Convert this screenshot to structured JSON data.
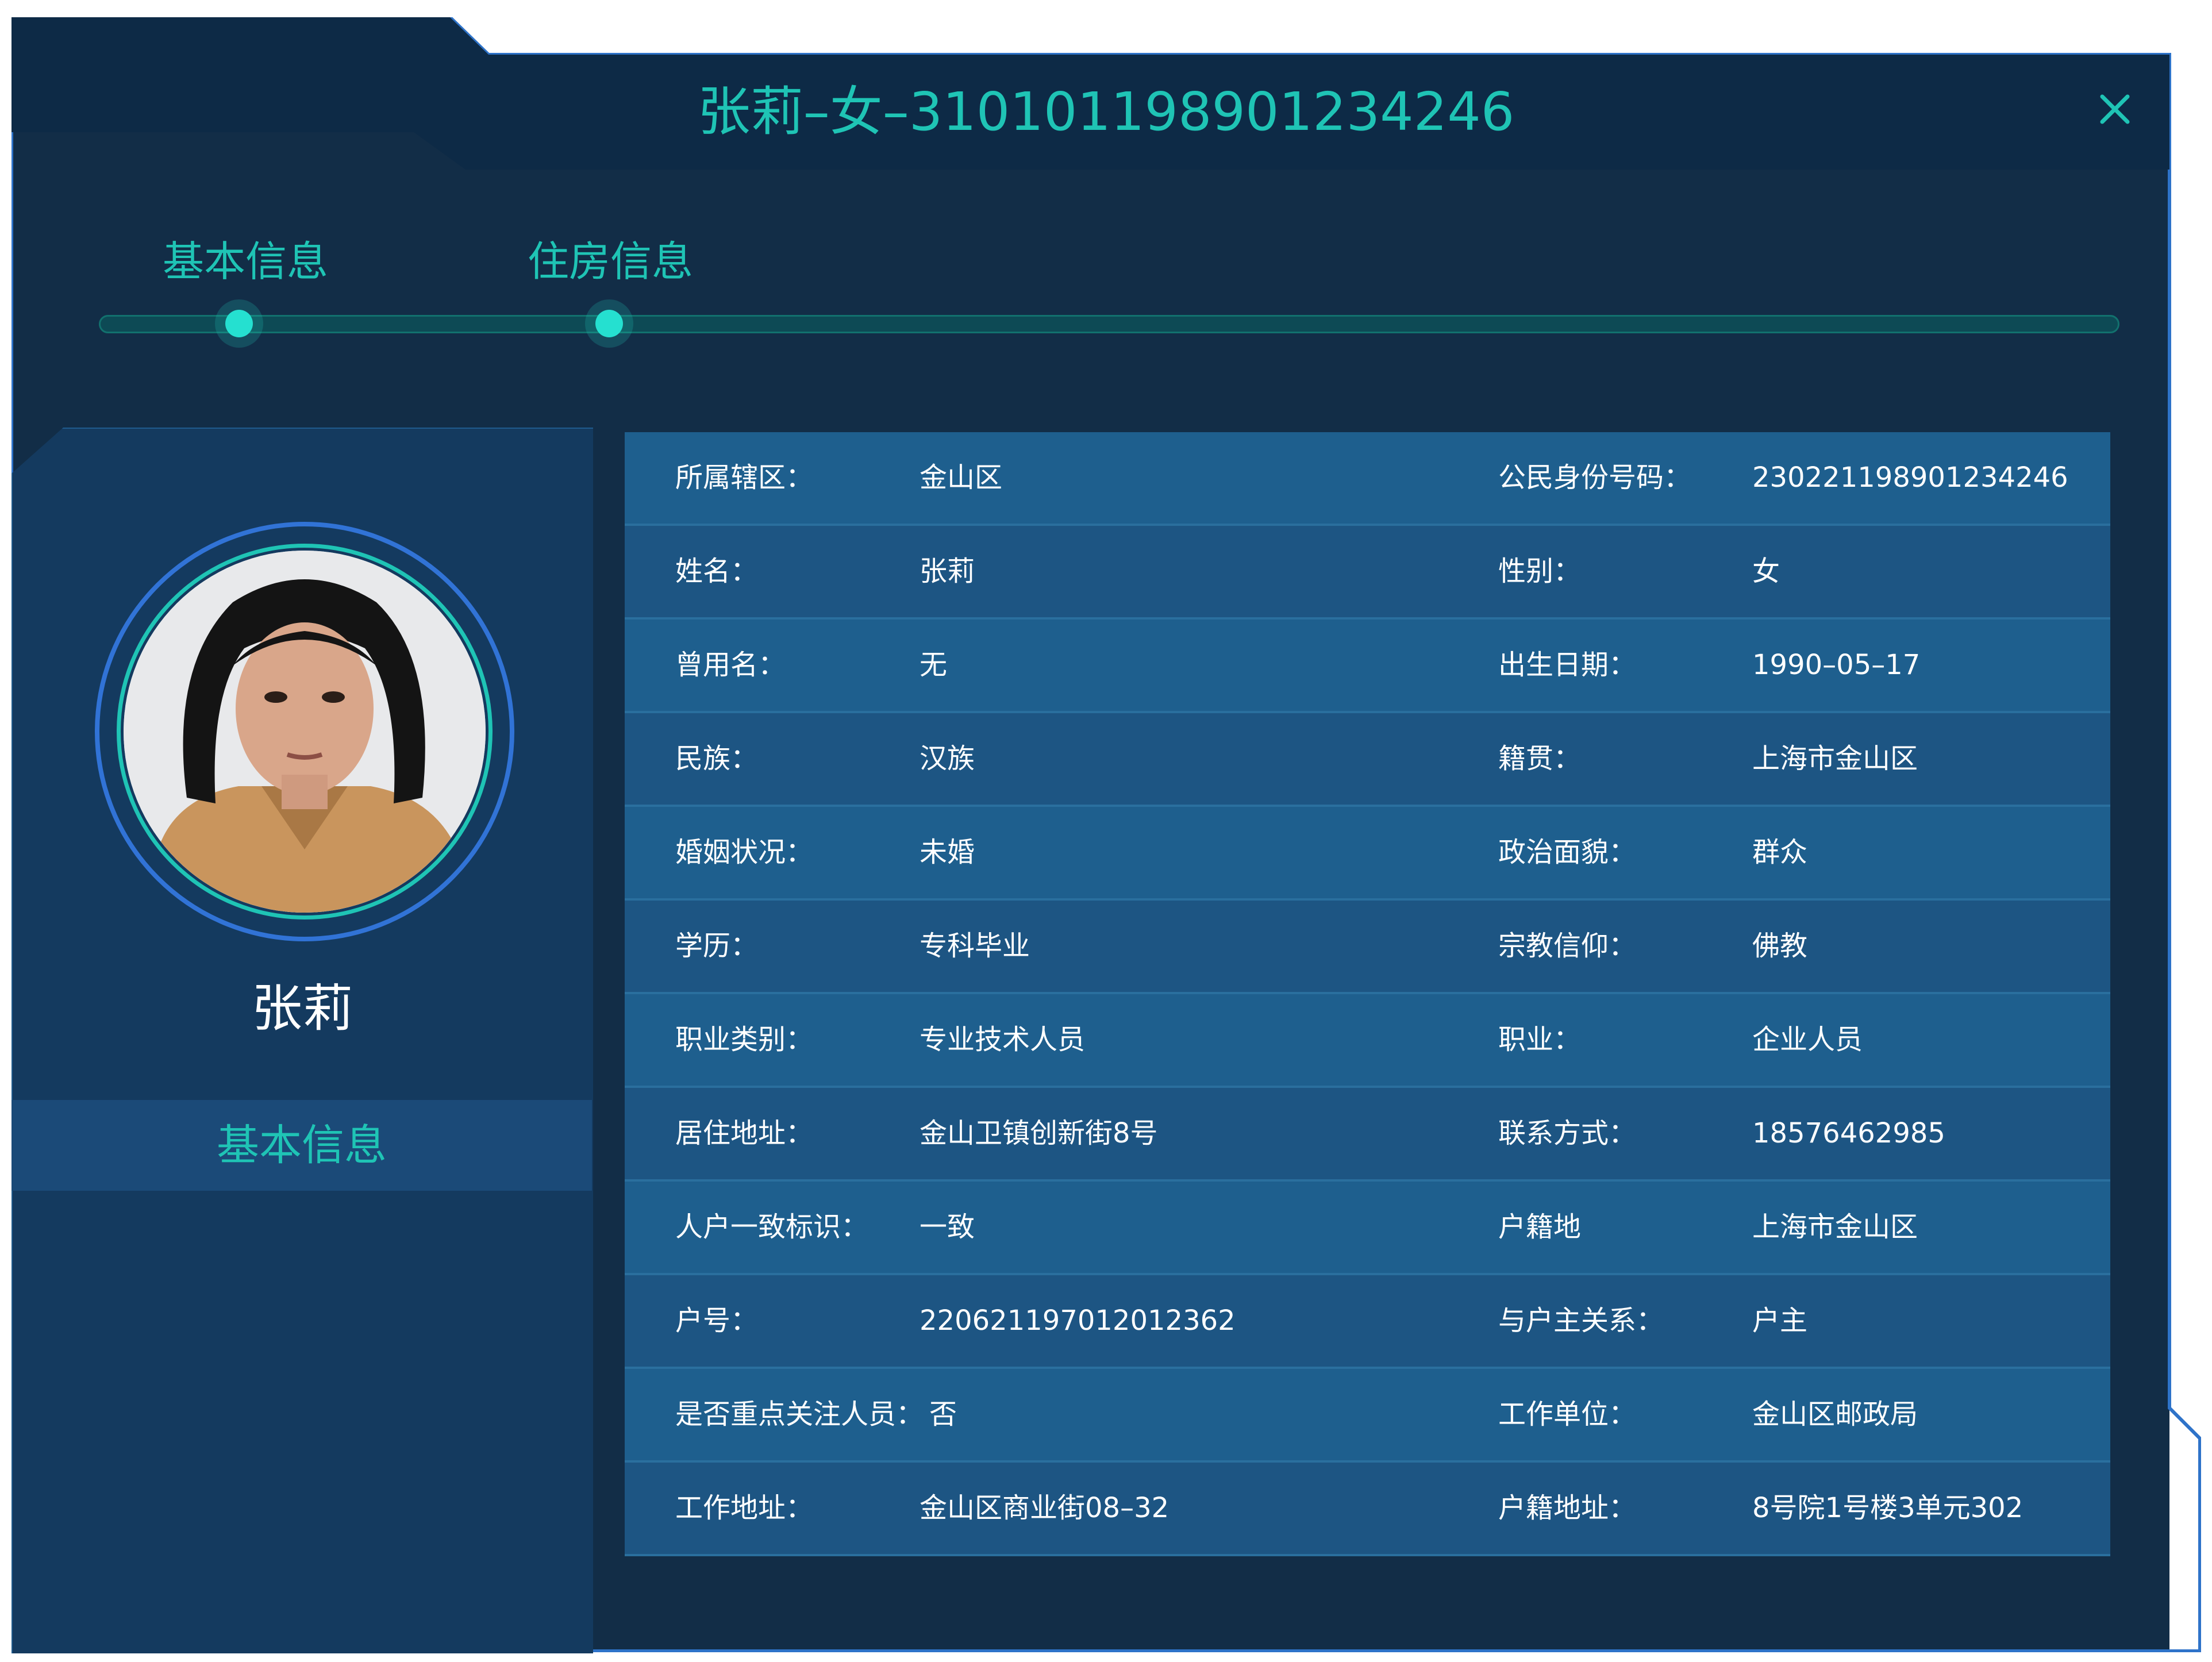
{
  "header": {
    "title": "张莉–女–310101198901234246",
    "close_icon": "close-icon"
  },
  "steps": [
    {
      "label": "基本信息"
    },
    {
      "label": "住房信息"
    }
  ],
  "profile": {
    "name": "张莉",
    "menu_item": "基本信息"
  },
  "info": {
    "rows": [
      {
        "label1": "所属辖区：",
        "value1": "金山区",
        "label2": "公民身份号码：",
        "value2": "230221198901234246"
      },
      {
        "label1": "姓名：",
        "value1": "张莉",
        "label2": "性别：",
        "value2": "女"
      },
      {
        "label1": "曾用名：",
        "value1": "无",
        "label2": "出生日期：",
        "value2": "1990–05–17"
      },
      {
        "label1": "民族：",
        "value1": "汉族",
        "label2": "籍贯：",
        "value2": "上海市金山区"
      },
      {
        "label1": "婚姻状况：",
        "value1": "未婚",
        "label2": "政治面貌：",
        "value2": "群众"
      },
      {
        "label1": "学历：",
        "value1": "专科毕业",
        "label2": "宗教信仰：",
        "value2": "佛教"
      },
      {
        "label1": "职业类别：",
        "value1": "专业技术人员",
        "label2": "职业：",
        "value2": "企业人员"
      },
      {
        "label1": "居住地址：",
        "value1": "金山卫镇创新街8号",
        "label2": "联系方式：",
        "value2": "18576462985"
      },
      {
        "label1": "人户一致标识：",
        "value1": "一致",
        "label2": "户籍地",
        "value2": "上海市金山区"
      },
      {
        "label1": "户号：",
        "value1": "220621197012012362",
        "label2": "与户主关系：",
        "value2": "户主"
      },
      {
        "label1": "是否重点关注人员：",
        "value1": "否",
        "label2": "工作单位：",
        "value2": "金山区邮政局"
      },
      {
        "label1": "工作地址：",
        "value1": "金山区商业街08–32",
        "label2": "户籍地址：",
        "value2": "8号院1号楼3单元302"
      }
    ]
  },
  "colors": {
    "accent": "#1fc4b5",
    "panel_bg": "#122d47",
    "row_bg": "#1e5f8e",
    "ring": "#3173d6"
  }
}
